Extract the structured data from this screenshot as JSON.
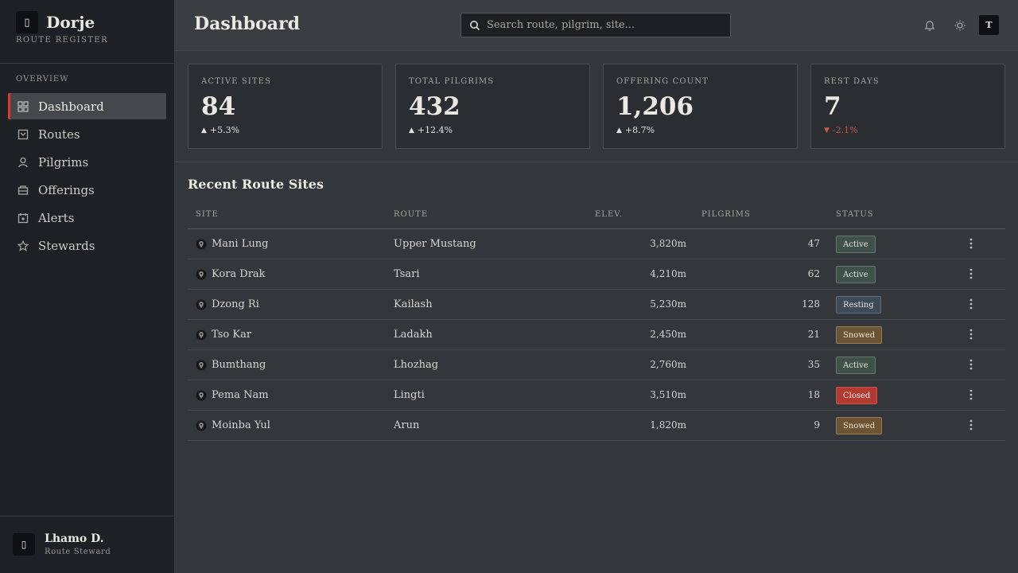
{
  "brand": {
    "name": "Dorje",
    "subtitle": "ROUTE REGISTER",
    "logo_glyph": "▯"
  },
  "sidebar": {
    "heading": "OVERVIEW",
    "items": [
      {
        "label": "Dashboard",
        "icon": "grid-icon",
        "active": true
      },
      {
        "label": "Routes",
        "icon": "map-icon",
        "active": false
      },
      {
        "label": "Pilgrims",
        "icon": "person-icon",
        "active": false
      },
      {
        "label": "Offerings",
        "icon": "offering-icon",
        "active": false
      },
      {
        "label": "Alerts",
        "icon": "calendar-alert-icon",
        "active": false
      },
      {
        "label": "Stewards",
        "icon": "star-icon",
        "active": false
      }
    ],
    "user": {
      "name": "Lhamo D.",
      "role": "Route Steward",
      "avatar_glyph": "▯"
    }
  },
  "header": {
    "title": "Dashboard",
    "search_placeholder": "Search route, pilgrim, site...",
    "avatar_letter": "T"
  },
  "stats": [
    {
      "label": "ACTIVE SITES",
      "value": "84",
      "delta": "+5.3%",
      "direction": "up"
    },
    {
      "label": "TOTAL PILGRIMS",
      "value": "432",
      "delta": "+12.4%",
      "direction": "up"
    },
    {
      "label": "OFFERING COUNT",
      "value": "1,206",
      "delta": "+8.7%",
      "direction": "up"
    },
    {
      "label": "REST DAYS",
      "value": "7",
      "delta": "-2.1%",
      "direction": "down"
    }
  ],
  "table": {
    "title": "Recent Route Sites",
    "columns": {
      "site": "SITE",
      "route": "ROUTE",
      "elev": "ELEV.",
      "pilgrims": "PILGRIMS",
      "status": "STATUS"
    },
    "rows": [
      {
        "site": "Mani Lung",
        "route": "Upper Mustang",
        "elev": "3,820m",
        "pilgrims": "47",
        "status": "Active",
        "status_kind": "active"
      },
      {
        "site": "Kora Drak",
        "route": "Tsari",
        "elev": "4,210m",
        "pilgrims": "62",
        "status": "Active",
        "status_kind": "active"
      },
      {
        "site": "Dzong Ri",
        "route": "Kailash",
        "elev": "5,230m",
        "pilgrims": "128",
        "status": "Resting",
        "status_kind": "resting"
      },
      {
        "site": "Tso Kar",
        "route": "Ladakh",
        "elev": "2,450m",
        "pilgrims": "21",
        "status": "Snowed",
        "status_kind": "snowed"
      },
      {
        "site": "Bumthang",
        "route": "Lhozhag",
        "elev": "2,760m",
        "pilgrims": "35",
        "status": "Active",
        "status_kind": "active"
      },
      {
        "site": "Pema Nam",
        "route": "Lingti",
        "elev": "3,510m",
        "pilgrims": "18",
        "status": "Closed",
        "status_kind": "closed"
      },
      {
        "site": "Moinba Yul",
        "route": "Arun",
        "elev": "1,820m",
        "pilgrims": "9",
        "status": "Snowed",
        "status_kind": "snowed"
      }
    ]
  },
  "colors": {
    "accent": "#c4453c",
    "sidebar_bg": "#1d2024",
    "main_bg": "#33363b",
    "down": "#d0574b"
  }
}
